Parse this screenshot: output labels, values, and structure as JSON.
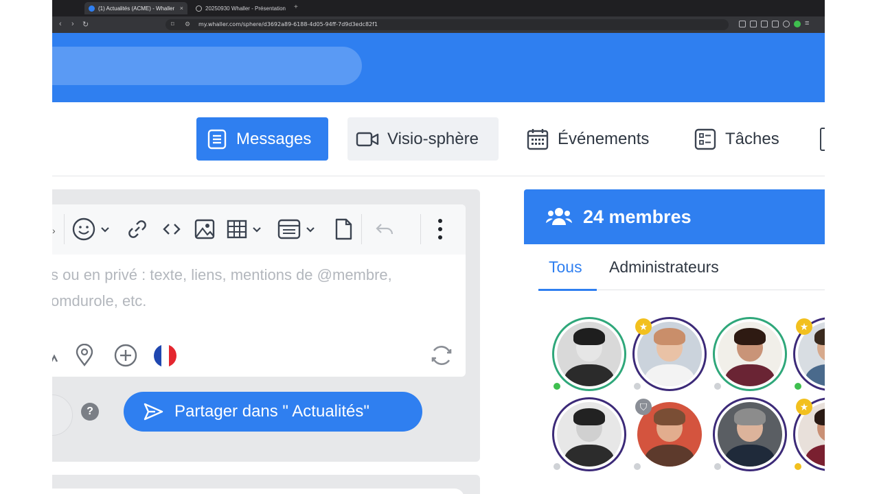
{
  "browser": {
    "tabs": [
      {
        "title": "(1) Actualités (ACME) - Whaller",
        "close": "×"
      },
      {
        "title": "20250930 Whaller - Présentation",
        "close": ""
      }
    ],
    "new_tab": "+",
    "url": "my.whaller.com/sphere/d3692a89-6188-4d05-94ff-7d9d3edc82f1"
  },
  "nav": {
    "messages": "Messages",
    "visio": "Visio-sphère",
    "events": "Événements",
    "tasks": "Tâches"
  },
  "editor": {
    "placeholder_line1": "s ou en privé : texte, liens, mentions de @membre,",
    "placeholder_line2": "omdurole, etc."
  },
  "share_button": "Partager dans \" Actualités\"",
  "help": "?",
  "members": {
    "title": "24 membres",
    "tab_all": "Tous",
    "tab_admins": "Administrateurs",
    "list": [
      {
        "status": "online",
        "badge": "none"
      },
      {
        "status": "offline",
        "badge": "star"
      },
      {
        "status": "offline",
        "badge": "none"
      },
      {
        "status": "online",
        "badge": "star"
      },
      {
        "status": "offline",
        "badge": "none"
      },
      {
        "status": "offline",
        "badge": "shield"
      },
      {
        "status": "offline",
        "badge": "none"
      },
      {
        "status": "away",
        "badge": "star"
      }
    ]
  },
  "colors": {
    "brand": "#2f7ff0",
    "online": "#3fbf4f",
    "offline": "#cfd2d6",
    "away": "#f2c01e",
    "busy": "#2a72e8",
    "star_badge": "#f2c01e",
    "shield_badge": "#8a8e96"
  }
}
